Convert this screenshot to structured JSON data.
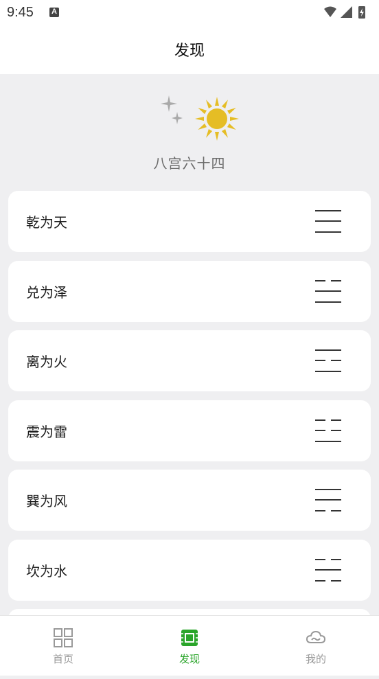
{
  "status_bar": {
    "time": "9:45"
  },
  "header": {
    "title": "发现"
  },
  "hero": {
    "title": "八宫六十四"
  },
  "items": [
    {
      "label": "乾为天",
      "trigram": [
        "yang",
        "yang",
        "yang"
      ]
    },
    {
      "label": "兑为泽",
      "trigram": [
        "yin",
        "yang",
        "yang"
      ]
    },
    {
      "label": "离为火",
      "trigram": [
        "yang",
        "yin",
        "yang"
      ]
    },
    {
      "label": "震为雷",
      "trigram": [
        "yin",
        "yin",
        "yang"
      ]
    },
    {
      "label": "巽为风",
      "trigram": [
        "yang",
        "yang",
        "yin"
      ]
    },
    {
      "label": "坎为水",
      "trigram": [
        "yin",
        "yang",
        "yin"
      ]
    }
  ],
  "bottom_nav": {
    "items": [
      {
        "label": "首页",
        "icon": "grid-icon"
      },
      {
        "label": "发现",
        "icon": "chip-icon"
      },
      {
        "label": "我的",
        "icon": "cloud-icon"
      }
    ],
    "active_index": 1
  },
  "colors": {
    "accent": "#2aa52a",
    "sun": "#e5bd25",
    "moon": "#a9a9a9"
  }
}
